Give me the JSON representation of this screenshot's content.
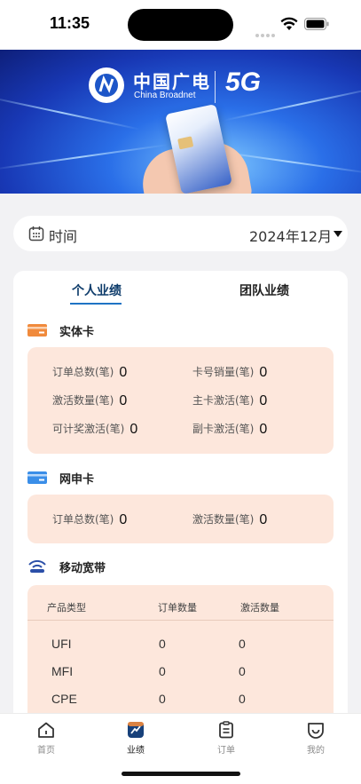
{
  "status_bar": {
    "time": "11:35"
  },
  "banner": {
    "brand_cn": "中国广电",
    "brand_en": "China Broadnet",
    "brand_5g": "5G"
  },
  "filter": {
    "label": "时间",
    "value": "2024年12月"
  },
  "tabs": [
    {
      "label": "个人业绩",
      "active": true
    },
    {
      "label": "团队业绩",
      "active": false
    }
  ],
  "sections": {
    "physical_card": {
      "title": "实体卡",
      "metrics": [
        {
          "label": "订单总数(笔)",
          "value": "0"
        },
        {
          "label": "卡号销量(笔)",
          "value": "0"
        },
        {
          "label": "激活数量(笔)",
          "value": "0"
        },
        {
          "label": "主卡激活(笔)",
          "value": "0"
        },
        {
          "label": "可计奖激活(笔)",
          "value": "0"
        },
        {
          "label": "副卡激活(笔)",
          "value": "0"
        }
      ]
    },
    "online_card": {
      "title": "网申卡",
      "metrics": [
        {
          "label": "订单总数(笔)",
          "value": "0"
        },
        {
          "label": "激活数量(笔)",
          "value": "0"
        }
      ]
    },
    "broadband": {
      "title": "移动宽带",
      "columns": [
        "产品类型",
        "订单数量",
        "激活数量"
      ],
      "rows": [
        {
          "type": "UFI",
          "orders": "0",
          "activations": "0"
        },
        {
          "type": "MFI",
          "orders": "0",
          "activations": "0"
        },
        {
          "type": "CPE",
          "orders": "0",
          "activations": "0"
        }
      ]
    }
  },
  "tabbar": [
    {
      "label": "首页",
      "icon": "home-icon",
      "active": false
    },
    {
      "label": "业绩",
      "icon": "performance-icon",
      "active": true
    },
    {
      "label": "订单",
      "icon": "order-clipboard-icon",
      "active": false
    },
    {
      "label": "我的",
      "icon": "profile-icon",
      "active": false
    }
  ],
  "colors": {
    "accent": "#1f73c4",
    "panel_bg": "#fde7dc",
    "section_orange": "#f08a3c",
    "section_blue": "#3a8ee8",
    "broadband_blue": "#2b4fa8"
  }
}
